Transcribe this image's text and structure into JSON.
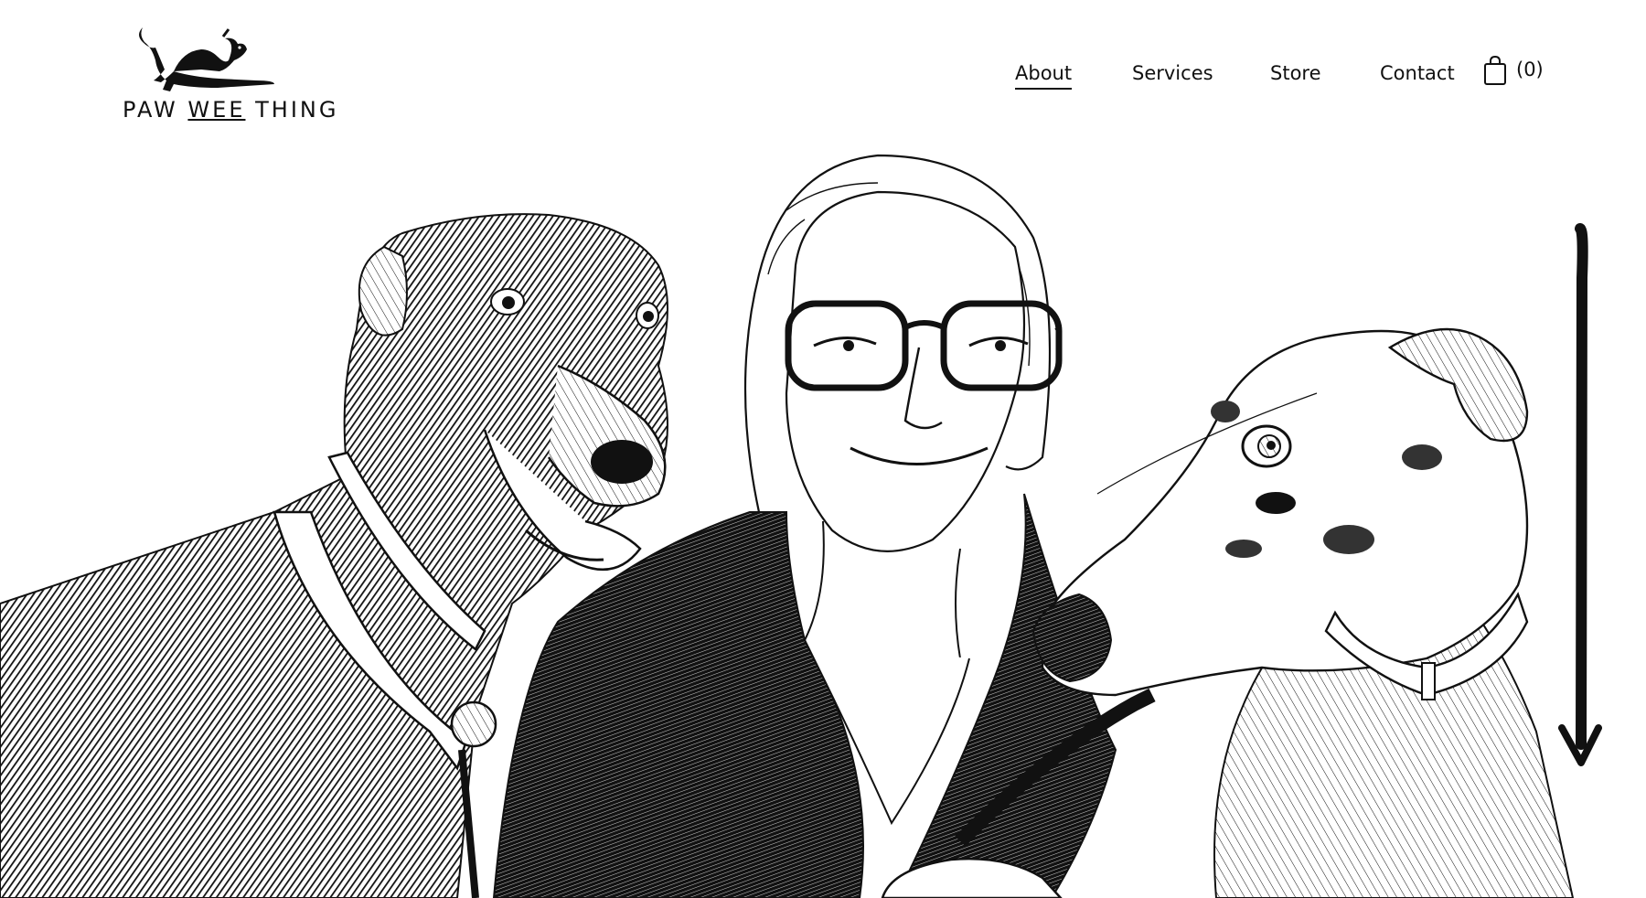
{
  "header": {
    "logo": {
      "name": "PAW WEE THING",
      "word1": "PAW",
      "word2": "WEE",
      "word3": "THING",
      "icon": "greyhound-logo-icon"
    },
    "nav": {
      "items": [
        {
          "label": "About",
          "active": true
        },
        {
          "label": "Services",
          "active": false
        },
        {
          "label": "Store",
          "active": false
        },
        {
          "label": "Contact",
          "active": false
        }
      ]
    },
    "cart": {
      "icon": "shopping-bag-icon",
      "count_label": "(0)"
    }
  },
  "hero": {
    "illustration": "ink-drawing-woman-with-greyhounds",
    "scroll_indicator": "arrow-down-icon"
  },
  "colors": {
    "background": "#ffffff",
    "ink": "#111111"
  }
}
